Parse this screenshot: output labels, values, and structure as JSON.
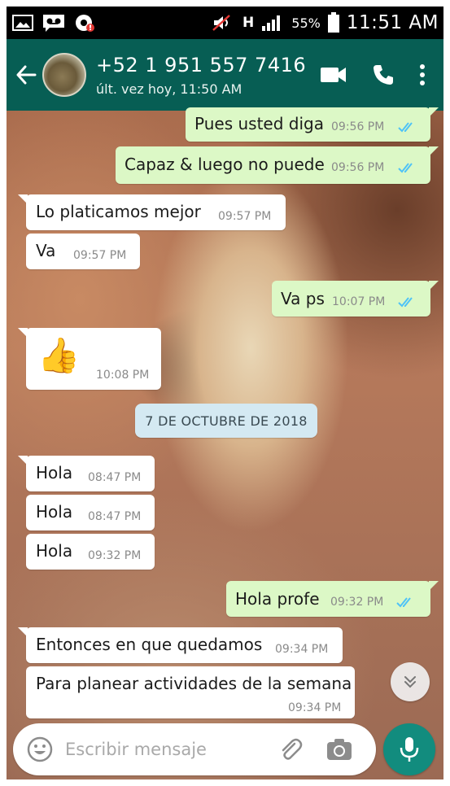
{
  "status_bar": {
    "battery_text": "55%",
    "time": "11:51 AM",
    "network_label": "H"
  },
  "header": {
    "contact_name": "+52 1 951 557 7416",
    "last_seen": "últ. vez hoy, 11:50 AM"
  },
  "messages": [
    {
      "direction": "out",
      "text": "Pues usted diga",
      "time": "09:56 PM",
      "status": "read"
    },
    {
      "direction": "out",
      "text": "Capaz & luego no puede",
      "time": "09:56 PM",
      "status": "read"
    },
    {
      "direction": "in",
      "text": "Lo platicamos mejor",
      "time": "09:57 PM"
    },
    {
      "direction": "in",
      "text": "Va",
      "time": "09:57 PM"
    },
    {
      "direction": "out",
      "text": "Va ps",
      "time": "10:07 PM",
      "status": "read"
    },
    {
      "direction": "in",
      "text": "👍",
      "time": "10:08 PM",
      "type": "emoji"
    },
    {
      "direction": "in",
      "text": "Hola",
      "time": "08:47 PM"
    },
    {
      "direction": "in",
      "text": "Hola",
      "time": "08:47 PM"
    },
    {
      "direction": "in",
      "text": "Hola",
      "time": "09:32 PM"
    },
    {
      "direction": "out",
      "text": "Hola profe",
      "time": "09:32 PM",
      "status": "read"
    },
    {
      "direction": "in",
      "text": "Entonces en que quedamos",
      "time": "09:34 PM"
    },
    {
      "direction": "in",
      "text": "Para planear actividades de la semana",
      "time": "09:34 PM"
    }
  ],
  "date_divider": "7 DE OCTUBRE DE 2018",
  "composer": {
    "placeholder": "Escribir mensaje"
  },
  "colors": {
    "header": "#075e54",
    "outgoing_bubble": "#dcf8c6",
    "incoming_bubble": "#ffffff",
    "read_ticks": "#4fc3f7",
    "mic_button": "#128c7e",
    "date_chip": "#d4e9f2"
  },
  "icons": {
    "status_left": [
      "gallery-icon",
      "voicemail-icon",
      "chrome-icon"
    ],
    "status_right": [
      "mute-icon",
      "signal-icon",
      "battery-icon"
    ],
    "header_actions": [
      "video-call-icon",
      "voice-call-icon",
      "more-options-icon"
    ],
    "composer": [
      "emoji-icon",
      "attach-icon",
      "camera-icon",
      "mic-icon"
    ]
  }
}
